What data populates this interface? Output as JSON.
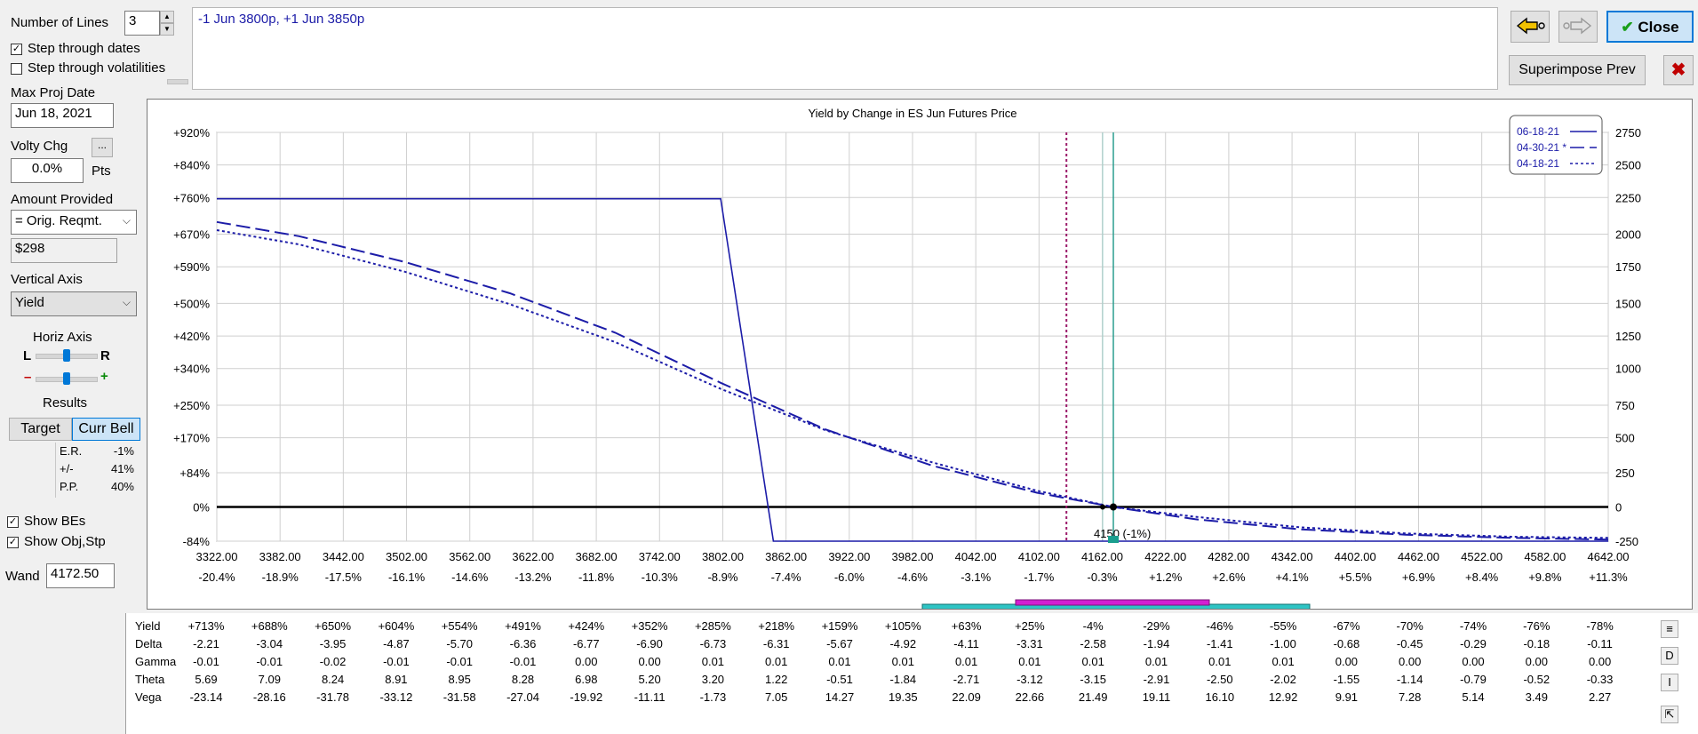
{
  "controls": {
    "number_of_lines_label": "Number of Lines",
    "number_of_lines_value": "3",
    "step_dates_label": "Step through dates",
    "step_dates_checked": true,
    "step_vols_label": "Step through volatilities",
    "step_vols_checked": false,
    "max_proj_date_label": "Max Proj Date",
    "max_proj_date_value": "Jun 18, 2021",
    "volty_chg_label": "Volty Chg",
    "volty_more": "...",
    "volty_value": "0.0%",
    "volty_unit": "Pts",
    "amount_provided_label": "Amount Provided",
    "amount_option": "= Orig. Reqmt.",
    "amount_value": "$298",
    "vertical_axis_label": "Vertical Axis",
    "vertical_axis_value": "Yield",
    "horiz_axis_label": "Horiz Axis",
    "horiz_l": "L",
    "horiz_r": "R",
    "horiz_minus": "–",
    "horiz_plus": "+",
    "results_label": "Results",
    "target_btn": "Target",
    "curr_bell_btn": "Curr Bell",
    "results": [
      {
        "k": "E.R.",
        "v": "-1%"
      },
      {
        "k": "+/-",
        "v": "41%"
      },
      {
        "k": "P.P.",
        "v": "40%"
      }
    ],
    "show_bes_label": "Show BEs",
    "show_bes_checked": true,
    "show_obj_label": "Show Obj,Stp",
    "show_obj_checked": true,
    "wand_label": "Wand",
    "wand_value": "4172.50"
  },
  "positions_text": "-1 Jun 3800p, +1 Jun 3850p",
  "buttons": {
    "close": "Close",
    "superimpose": "Superimpose Prev",
    "close_mark": "✔",
    "x_mark": "✖"
  },
  "colors": {
    "accent": "#0078d7",
    "series": "#1c1ca8",
    "be_line": "#9b1b6a",
    "wand_line": "#2a9d8f"
  },
  "chart_data": {
    "type": "line",
    "title": "Yield by Change in ES Jun Futures Price",
    "x_ticks": [
      3322,
      3382,
      3442,
      3502,
      3562,
      3622,
      3682,
      3742,
      3802,
      3862,
      3922,
      3982,
      4042,
      4102,
      4162,
      4222,
      4282,
      4342,
      4402,
      4462,
      4522,
      4582,
      4642
    ],
    "x_tick_labels": [
      "3322.00",
      "3382.00",
      "3442.00",
      "3502.00",
      "3562.00",
      "3622.00",
      "3682.00",
      "3742.00",
      "3802.00",
      "3862.00",
      "3922.00",
      "3982.00",
      "4042.00",
      "4102.00",
      "4162.00",
      "4222.00",
      "4282.00",
      "4342.00",
      "4402.00",
      "4462.00",
      "4522.00",
      "4582.00",
      "4642.00"
    ],
    "x_pct_labels": [
      "-20.4%",
      "-18.9%",
      "-17.5%",
      "-16.1%",
      "-14.6%",
      "-13.2%",
      "-11.8%",
      "-10.3%",
      "-8.9%",
      "-7.4%",
      "-6.0%",
      "-4.6%",
      "-3.1%",
      "-1.7%",
      "-0.3%",
      "+1.2%",
      "+2.6%",
      "+4.1%",
      "+5.5%",
      "+6.9%",
      "+8.4%",
      "+9.8%",
      "+11.3%"
    ],
    "xlim": [
      3322,
      4642
    ],
    "y_left_ticks": [
      -84,
      0,
      84,
      170,
      250,
      340,
      420,
      500,
      590,
      670,
      760,
      840,
      920
    ],
    "y_left_labels": [
      "-84%",
      "0%",
      "+84%",
      "+170%",
      "+250%",
      "+340%",
      "+420%",
      "+500%",
      "+590%",
      "+670%",
      "+760%",
      "+840%",
      "+920%"
    ],
    "y_right_labels": [
      "-250",
      "0",
      "250",
      "500",
      "750",
      "1000",
      "1250",
      "1500",
      "1750",
      "2000",
      "2250",
      "2500",
      "2750"
    ],
    "ylim": [
      -84,
      920
    ],
    "series": [
      {
        "name": "06-18-21",
        "style": "solid",
        "x": [
          3322,
          3800,
          3850,
          4642
        ],
        "y": [
          757,
          757,
          -84,
          -84
        ]
      },
      {
        "name": "04-30-21 *",
        "style": "dashed",
        "x": [
          3322,
          3400,
          3500,
          3600,
          3700,
          3800,
          3900,
          4000,
          4100,
          4172.5,
          4250,
          4350,
          4450,
          4550,
          4642
        ],
        "y": [
          700,
          665,
          602,
          525,
          428,
          305,
          190,
          102,
          35,
          0,
          -30,
          -55,
          -68,
          -76,
          -80
        ]
      },
      {
        "name": "04-18-21",
        "style": "dotted",
        "x": [
          3322,
          3400,
          3500,
          3600,
          3700,
          3800,
          3900,
          4000,
          4100,
          4172.5,
          4250,
          4350,
          4450,
          4550,
          4642
        ],
        "y": [
          680,
          645,
          578,
          498,
          405,
          290,
          188,
          110,
          40,
          0,
          -24,
          -50,
          -65,
          -73,
          -76
        ]
      }
    ],
    "vlines": [
      {
        "x": 4128,
        "style": "dotted-magenta"
      },
      {
        "x": 4172.5,
        "style": "solid-teal"
      }
    ],
    "wand_label": "4150 (-1%)",
    "grid": true,
    "legend_position": "top-right"
  },
  "table": {
    "rows": [
      {
        "label": "Yield",
        "values": [
          "+713%",
          "+688%",
          "+650%",
          "+604%",
          "+554%",
          "+491%",
          "+424%",
          "+352%",
          "+285%",
          "+218%",
          "+159%",
          "+105%",
          "+63%",
          "+25%",
          "-4%",
          "-29%",
          "-46%",
          "-55%",
          "-67%",
          "-70%",
          "-74%",
          "-76%",
          "-78%"
        ]
      },
      {
        "label": "Delta",
        "values": [
          "-2.21",
          "-3.04",
          "-3.95",
          "-4.87",
          "-5.70",
          "-6.36",
          "-6.77",
          "-6.90",
          "-6.73",
          "-6.31",
          "-5.67",
          "-4.92",
          "-4.11",
          "-3.31",
          "-2.58",
          "-1.94",
          "-1.41",
          "-1.00",
          "-0.68",
          "-0.45",
          "-0.29",
          "-0.18",
          "-0.11"
        ]
      },
      {
        "label": "Gamma",
        "values": [
          "-0.01",
          "-0.01",
          "-0.02",
          "-0.01",
          "-0.01",
          "-0.01",
          "0.00",
          "0.00",
          "0.01",
          "0.01",
          "0.01",
          "0.01",
          "0.01",
          "0.01",
          "0.01",
          "0.01",
          "0.01",
          "0.01",
          "0.00",
          "0.00",
          "0.00",
          "0.00",
          "0.00"
        ]
      },
      {
        "label": "Theta",
        "values": [
          "5.69",
          "7.09",
          "8.24",
          "8.91",
          "8.95",
          "8.28",
          "6.98",
          "5.20",
          "3.20",
          "1.22",
          "-0.51",
          "-1.84",
          "-2.71",
          "-3.12",
          "-3.15",
          "-2.91",
          "-2.50",
          "-2.02",
          "-1.55",
          "-1.14",
          "-0.79",
          "-0.52",
          "-0.33"
        ]
      },
      {
        "label": "Vega",
        "values": [
          "-23.14",
          "-28.16",
          "-31.78",
          "-33.12",
          "-31.58",
          "-27.04",
          "-19.92",
          "-11.11",
          "-1.73",
          "7.05",
          "14.27",
          "19.35",
          "22.09",
          "22.66",
          "21.49",
          "19.11",
          "16.10",
          "12.92",
          "9.91",
          "7.28",
          "5.14",
          "3.49",
          "2.27"
        ]
      }
    ],
    "side_buttons": [
      "D",
      "I"
    ]
  }
}
